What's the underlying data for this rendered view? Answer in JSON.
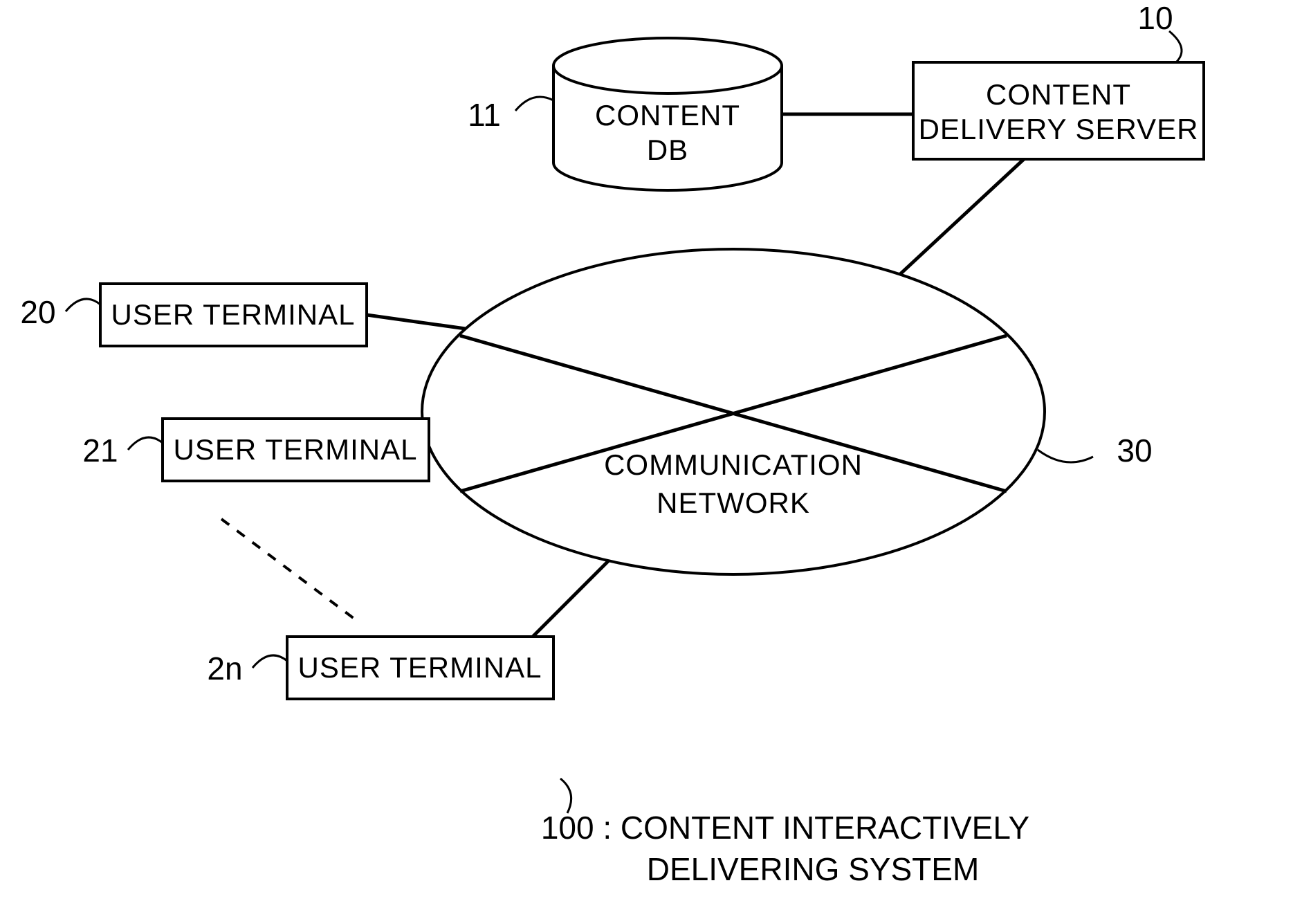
{
  "nodes": {
    "server": {
      "ref": "10",
      "label1": "CONTENT",
      "label2": "DELIVERY SERVER"
    },
    "db": {
      "ref": "11",
      "label1": "CONTENT",
      "label2": "DB"
    },
    "network": {
      "ref": "30",
      "label1": "COMMUNICATION",
      "label2": "NETWORK"
    },
    "term0": {
      "ref": "20",
      "label": "USER TERMINAL"
    },
    "term1": {
      "ref": "21",
      "label": "USER TERMINAL"
    },
    "termN": {
      "ref": "2n",
      "label": "USER TERMINAL"
    }
  },
  "caption": {
    "ref": "100",
    "line1": "CONTENT INTERACTIVELY",
    "line2": "DELIVERING SYSTEM",
    "sep": ":"
  }
}
